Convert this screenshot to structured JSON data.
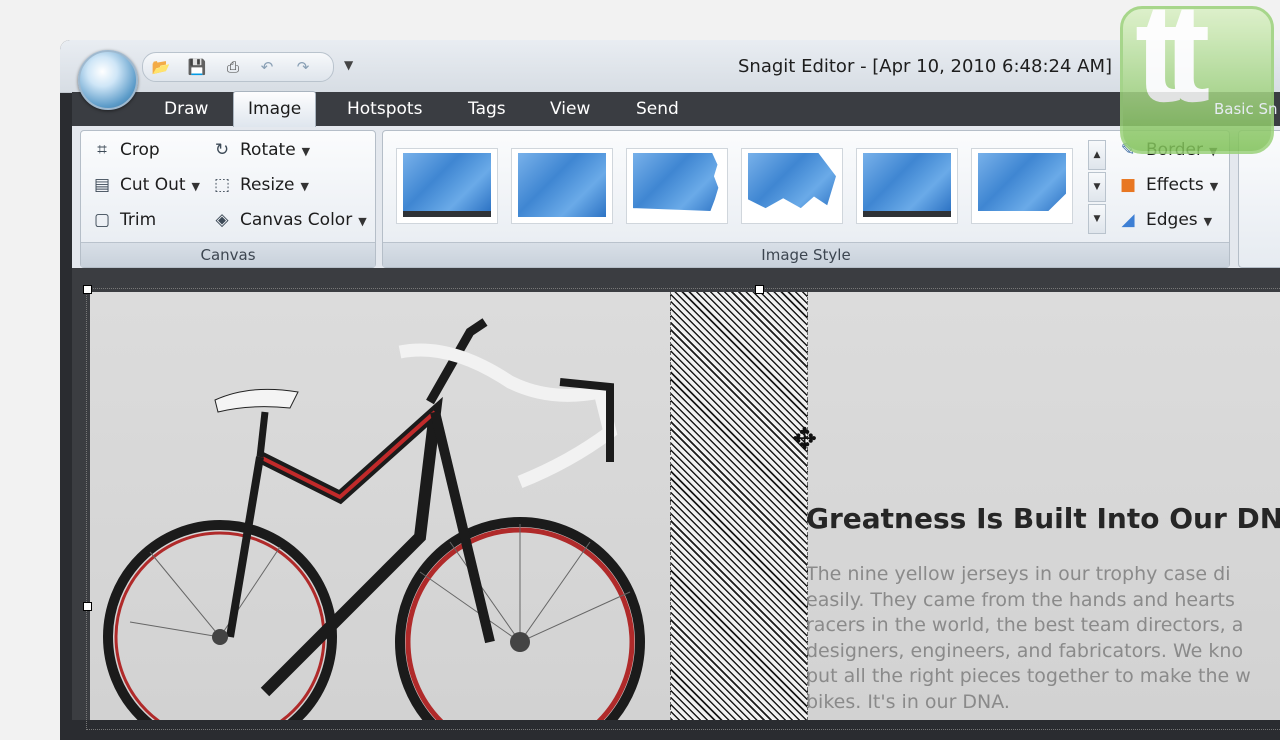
{
  "window": {
    "title": "Snagit Editor - [Apr 10, 2010 6:48:24 AM]"
  },
  "quick_access": {
    "icons": [
      "open-icon",
      "save-icon",
      "print-icon",
      "undo-icon",
      "redo-icon"
    ]
  },
  "tabs": [
    {
      "label": "Draw"
    },
    {
      "label": "Image",
      "active": true
    },
    {
      "label": "Hotspots"
    },
    {
      "label": "Tags"
    },
    {
      "label": "View"
    },
    {
      "label": "Send"
    }
  ],
  "canvas_group": {
    "label": "Canvas",
    "commands": {
      "crop": "Crop",
      "rotate": "Rotate",
      "cut_out": "Cut Out",
      "resize": "Resize",
      "trim": "Trim",
      "canvas_color": "Canvas Color"
    }
  },
  "image_style_group": {
    "label": "Image Style",
    "border": "Border",
    "effects": "Effects",
    "edges": "Edges"
  },
  "right_panel": {
    "label": "Basic Sn"
  },
  "document": {
    "headline": "Greatness Is Built Into Our DNA",
    "paragraph_lines": [
      "The nine yellow jerseys in our trophy case di",
      "easily. They came from the hands and hearts",
      "racers in the world, the best team directors, a",
      "designers, engineers, and fabricators. We kno",
      "put all the right pieces together to make the w",
      "bikes. It's in our DNA."
    ]
  },
  "logo": {
    "text": "tt"
  },
  "colors": {
    "ribbon_bg": "#e4e8ee",
    "tab_active": "#ffffff",
    "logo_green": "#7fc157"
  }
}
